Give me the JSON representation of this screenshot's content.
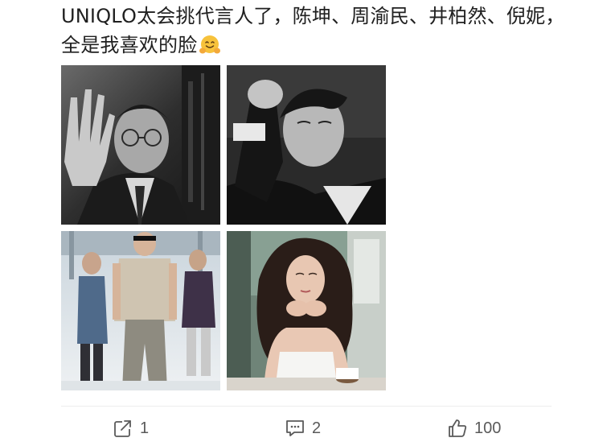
{
  "post": {
    "text": "UNIQLO太会挑代言人了，陈坤、周渝民、井柏然、倪妮，全是我喜欢的脸",
    "emoji": "hugging-face-emoji"
  },
  "photos": [
    {
      "subject": "man in glasses and suit raising hand, black and white"
    },
    {
      "subject": "man resting head on hand, black and white portrait"
    },
    {
      "subject": "man in beige polo walking through airport"
    },
    {
      "subject": "woman in white top resting chin on hands at cafe"
    }
  ],
  "actions": {
    "repost_count": "1",
    "comment_count": "2",
    "like_count": "100"
  },
  "colors": {
    "text": "#202020",
    "action": "#5a5a5a",
    "divider": "#ececec"
  }
}
